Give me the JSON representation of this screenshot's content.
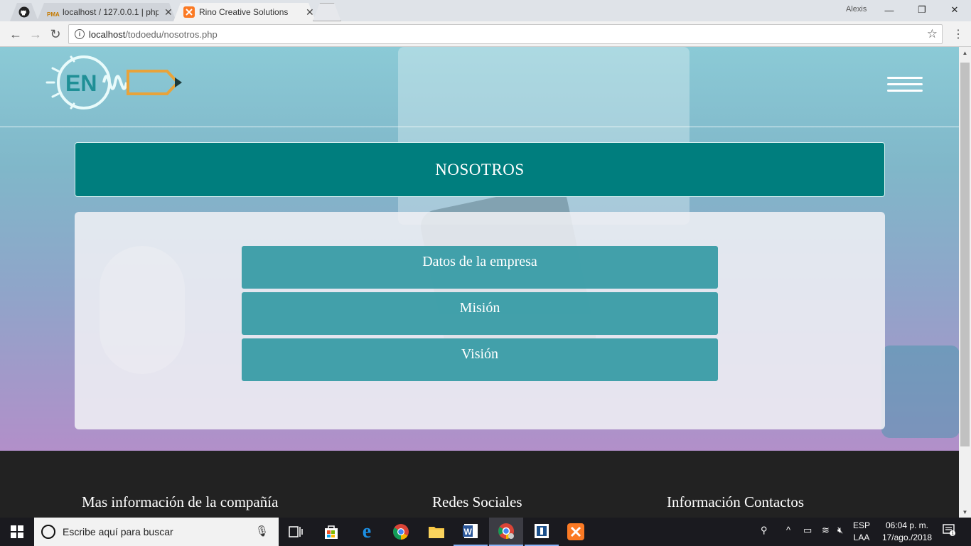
{
  "browser": {
    "tabs": [
      {
        "label": "localhost / 127.0.0.1 | php",
        "icon": "phpmyadmin-icon"
      },
      {
        "label": "Rino Creative Solutions",
        "icon": "xampp-icon"
      }
    ],
    "window_user": "Alexis",
    "window_controls": {
      "minimize": "—",
      "restore": "❐",
      "close": "✕"
    },
    "address": {
      "host": "localhost",
      "path": "/todoedu/nosotros.php"
    }
  },
  "page": {
    "logo_text": "EN",
    "title": "NOSOTROS",
    "menu_items": [
      {
        "label": "Datos de la empresa"
      },
      {
        "label": "Misión"
      },
      {
        "label": "Visión"
      }
    ],
    "footer": {
      "col1": "Mas información de la compañía",
      "col2": "Redes Sociales",
      "col3": "Información Contactos"
    }
  },
  "taskbar": {
    "search_placeholder": "Escribe aquí para buscar",
    "apps": [
      "task-view-icon",
      "store-icon",
      "edge-icon",
      "chrome-icon",
      "file-explorer-icon",
      "word-icon",
      "chrome-profile-icon",
      "app-icon",
      "xampp-icon"
    ],
    "language": {
      "line1": "ESP",
      "line2": "LAA"
    },
    "time": "06:04 p. m.",
    "date": "17/ago./2018",
    "notifications": "1"
  },
  "colors": {
    "title_bar": "#007e7e",
    "menu_button": "#2b96a0",
    "footer_bg": "#222222",
    "logo_teal": "#2aa6a6",
    "logo_orange": "#e8a33a"
  }
}
